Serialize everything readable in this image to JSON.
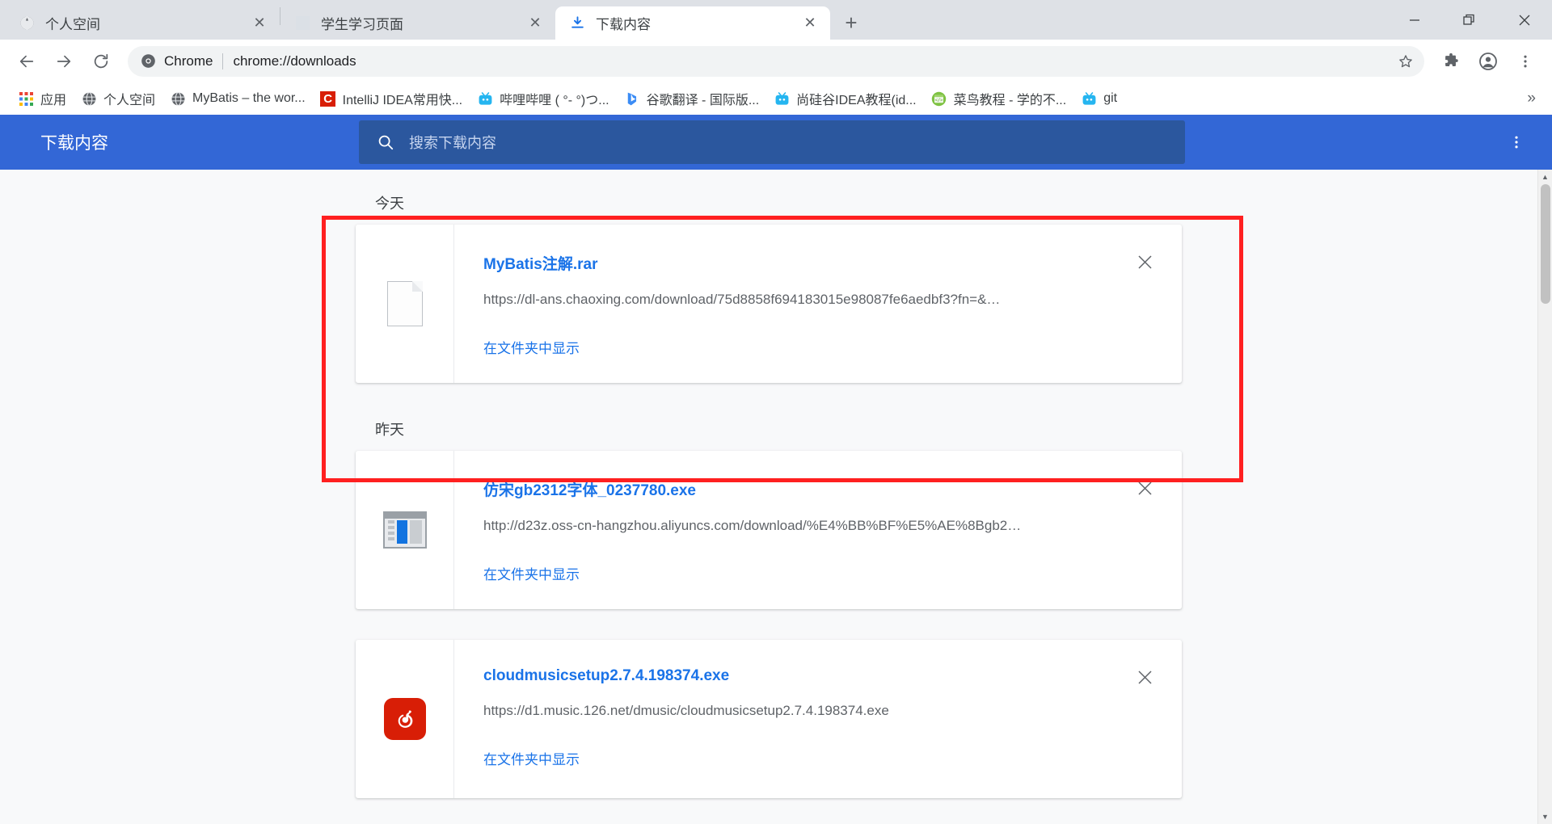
{
  "window": {
    "controls": [
      {
        "name": "minimize",
        "glyph": "—"
      },
      {
        "name": "restore",
        "glyph": "❐"
      },
      {
        "name": "close",
        "glyph": "✕"
      }
    ]
  },
  "tabs": [
    {
      "title": "个人空间",
      "icon": "globe-icon",
      "active": false,
      "close": "✕"
    },
    {
      "title": "学生学习页面",
      "icon": "blank-page-icon",
      "active": false,
      "close": "✕"
    },
    {
      "title": "下载内容",
      "icon": "download-icon",
      "active": true,
      "close": "✕"
    }
  ],
  "new_tab_glyph": "+",
  "toolbar": {
    "back_icon": "back-arrow-icon",
    "forward_icon": "forward-arrow-icon",
    "reload_icon": "reload-icon",
    "chrome_label": "Chrome",
    "url": "chrome://downloads",
    "star_icon": "star-icon",
    "extensions_icon": "puzzle-icon",
    "profile_icon": "account-icon",
    "menu_icon": "three-dot-menu-icon"
  },
  "bookmarks": {
    "items": [
      {
        "label": "应用",
        "icon": "apps-grid-icon"
      },
      {
        "label": "个人空间",
        "icon": "globe-icon"
      },
      {
        "label": "MyBatis – the wor...",
        "icon": "globe-icon"
      },
      {
        "label": "IntelliJ IDEA常用快...",
        "icon": "csdn-icon"
      },
      {
        "label": "哔哩哔哩 ( °- °)つ...",
        "icon": "bilibili-icon"
      },
      {
        "label": "谷歌翻译 - 国际版...",
        "icon": "bing-icon"
      },
      {
        "label": "尚硅谷IDEA教程(id...",
        "icon": "bilibili-icon"
      },
      {
        "label": "菜鸟教程 - 学的不...",
        "icon": "runoob-icon"
      },
      {
        "label": "git",
        "icon": "bilibili-icon"
      }
    ],
    "overflow_glyph": "»"
  },
  "downloads_page": {
    "title": "下载内容",
    "search_placeholder": "搜索下载内容",
    "search_icon": "search-icon",
    "more_icon": "three-dot-menu-icon",
    "show_in_folder_label": "在文件夹中显示",
    "remove_glyph": "✕",
    "groups": [
      {
        "day": "今天",
        "items": [
          {
            "filename": "MyBatis注解.rar",
            "url": "https://dl-ans.chaoxing.com/download/75d8858f694183015e98087fe6aedbf3?fn=&…",
            "icon": "generic-file-icon"
          }
        ]
      },
      {
        "day": "昨天",
        "items": [
          {
            "filename": "仿宋gb2312字体_0237780.exe",
            "url": "http://d23z.oss-cn-hangzhou.aliyuncs.com/download/%E4%BB%BF%E5%AE%8Bgb2…",
            "icon": "installer-icon"
          },
          {
            "filename": "cloudmusicsetup2.7.4.198374.exe",
            "url": "https://d1.music.126.net/dmusic/cloudmusicsetup2.7.4.198374.exe",
            "icon": "netease-music-icon"
          }
        ]
      }
    ]
  },
  "scrollbar": {
    "up_glyph": "▲",
    "down_glyph": "▼"
  },
  "colors": {
    "header_blue": "#3367d6",
    "search_blue": "#2b579e",
    "link_blue": "#1a73e8",
    "annotation_red": "#ff2020",
    "tabstrip_grey": "#dee1e6"
  }
}
